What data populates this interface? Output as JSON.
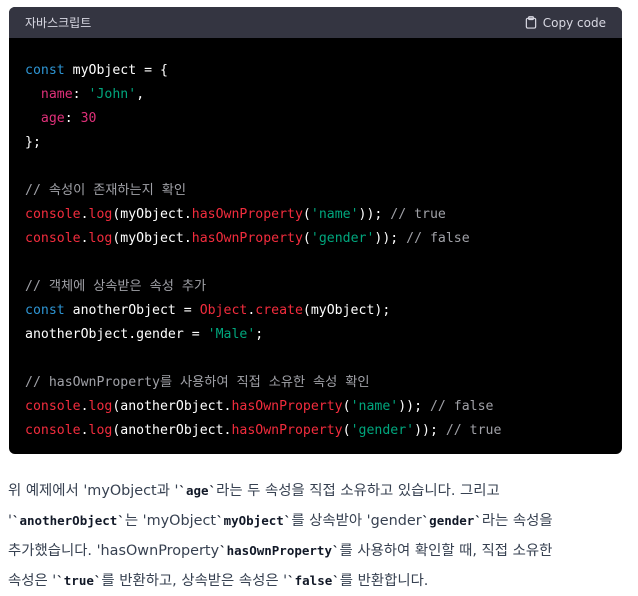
{
  "code_block": {
    "language": "자바스크립트",
    "copy_label": "Copy code",
    "lines": [
      [
        {
          "t": "kw",
          "v": "const "
        },
        {
          "t": "plain",
          "v": "myObject = {"
        }
      ],
      [
        {
          "t": "plain",
          "v": "  "
        },
        {
          "t": "prop",
          "v": "name"
        },
        {
          "t": "plain",
          "v": ": "
        },
        {
          "t": "str",
          "v": "'John'"
        },
        {
          "t": "plain",
          "v": ","
        }
      ],
      [
        {
          "t": "plain",
          "v": "  "
        },
        {
          "t": "prop",
          "v": "age"
        },
        {
          "t": "plain",
          "v": ": "
        },
        {
          "t": "num",
          "v": "30"
        }
      ],
      [
        {
          "t": "plain",
          "v": "};"
        }
      ],
      [
        {
          "t": "plain",
          "v": ""
        }
      ],
      [
        {
          "t": "cm",
          "v": "// 속성이 존재하는지 확인"
        }
      ],
      [
        {
          "t": "fn",
          "v": "console"
        },
        {
          "t": "plain",
          "v": "."
        },
        {
          "t": "fn",
          "v": "log"
        },
        {
          "t": "plain",
          "v": "(myObject."
        },
        {
          "t": "fn",
          "v": "hasOwnProperty"
        },
        {
          "t": "plain",
          "v": "("
        },
        {
          "t": "str",
          "v": "'name'"
        },
        {
          "t": "plain",
          "v": ")); "
        },
        {
          "t": "cm",
          "v": "// true"
        }
      ],
      [
        {
          "t": "fn",
          "v": "console"
        },
        {
          "t": "plain",
          "v": "."
        },
        {
          "t": "fn",
          "v": "log"
        },
        {
          "t": "plain",
          "v": "(myObject."
        },
        {
          "t": "fn",
          "v": "hasOwnProperty"
        },
        {
          "t": "plain",
          "v": "("
        },
        {
          "t": "str",
          "v": "'gender'"
        },
        {
          "t": "plain",
          "v": ")); "
        },
        {
          "t": "cm",
          "v": "// false"
        }
      ],
      [
        {
          "t": "plain",
          "v": ""
        }
      ],
      [
        {
          "t": "cm",
          "v": "// 객체에 상속받은 속성 추가"
        }
      ],
      [
        {
          "t": "kw",
          "v": "const "
        },
        {
          "t": "plain",
          "v": "anotherObject = "
        },
        {
          "t": "fn",
          "v": "Object"
        },
        {
          "t": "plain",
          "v": "."
        },
        {
          "t": "fn",
          "v": "create"
        },
        {
          "t": "plain",
          "v": "(myObject);"
        }
      ],
      [
        {
          "t": "plain",
          "v": "anotherObject.gender = "
        },
        {
          "t": "str",
          "v": "'Male'"
        },
        {
          "t": "plain",
          "v": ";"
        }
      ],
      [
        {
          "t": "plain",
          "v": ""
        }
      ],
      [
        {
          "t": "cm",
          "v": "// hasOwnProperty를 사용하여 직접 소유한 속성 확인"
        }
      ],
      [
        {
          "t": "fn",
          "v": "console"
        },
        {
          "t": "plain",
          "v": "."
        },
        {
          "t": "fn",
          "v": "log"
        },
        {
          "t": "plain",
          "v": "(anotherObject."
        },
        {
          "t": "fn",
          "v": "hasOwnProperty"
        },
        {
          "t": "plain",
          "v": "("
        },
        {
          "t": "str",
          "v": "'name'"
        },
        {
          "t": "plain",
          "v": ")); "
        },
        {
          "t": "cm",
          "v": "// false"
        }
      ],
      [
        {
          "t": "fn",
          "v": "console"
        },
        {
          "t": "plain",
          "v": "."
        },
        {
          "t": "fn",
          "v": "log"
        },
        {
          "t": "plain",
          "v": "(anotherObject."
        },
        {
          "t": "fn",
          "v": "hasOwnProperty"
        },
        {
          "t": "plain",
          "v": "("
        },
        {
          "t": "str",
          "v": "'gender'"
        },
        {
          "t": "plain",
          "v": ")); "
        },
        {
          "t": "cm",
          "v": "// true"
        }
      ]
    ]
  },
  "prose": [
    [
      {
        "t": "text",
        "v": "위 예제에서 'myObject과 '"
      },
      {
        "t": "code",
        "v": "`age`"
      },
      {
        "t": "text",
        "v": "라는 두 속성을 직접 소유하고 있습니다. 그리고"
      }
    ],
    [
      {
        "t": "text",
        "v": "'"
      },
      {
        "t": "code",
        "v": "`anotherObject`"
      },
      {
        "t": "text",
        "v": "는 'myObject"
      },
      {
        "t": "code",
        "v": "`myObject`"
      },
      {
        "t": "text",
        "v": "를 상속받아 'gender"
      },
      {
        "t": "code",
        "v": "`gender`"
      },
      {
        "t": "text",
        "v": "라는 속성을"
      }
    ],
    [
      {
        "t": "text",
        "v": "추가했습니다. 'hasOwnProperty"
      },
      {
        "t": "code",
        "v": "`hasOwnProperty`"
      },
      {
        "t": "text",
        "v": "를 사용하여 확인할 때, 직접 소유한"
      }
    ],
    [
      {
        "t": "text",
        "v": "속성은 '"
      },
      {
        "t": "code",
        "v": "`true`"
      },
      {
        "t": "text",
        "v": "를 반환하고, 상속받은 속성은 '"
      },
      {
        "t": "code",
        "v": "`false`"
      },
      {
        "t": "text",
        "v": "를 반환합니다."
      }
    ]
  ],
  "colors": {
    "keyword": "#2e95d3",
    "property": "#df3079",
    "string": "#00a67d",
    "comment": "#a0a1a7",
    "function": "#f22c3d",
    "header_bg": "#343541",
    "code_bg": "#000000"
  },
  "icons": {
    "copy": "clipboard-icon"
  }
}
